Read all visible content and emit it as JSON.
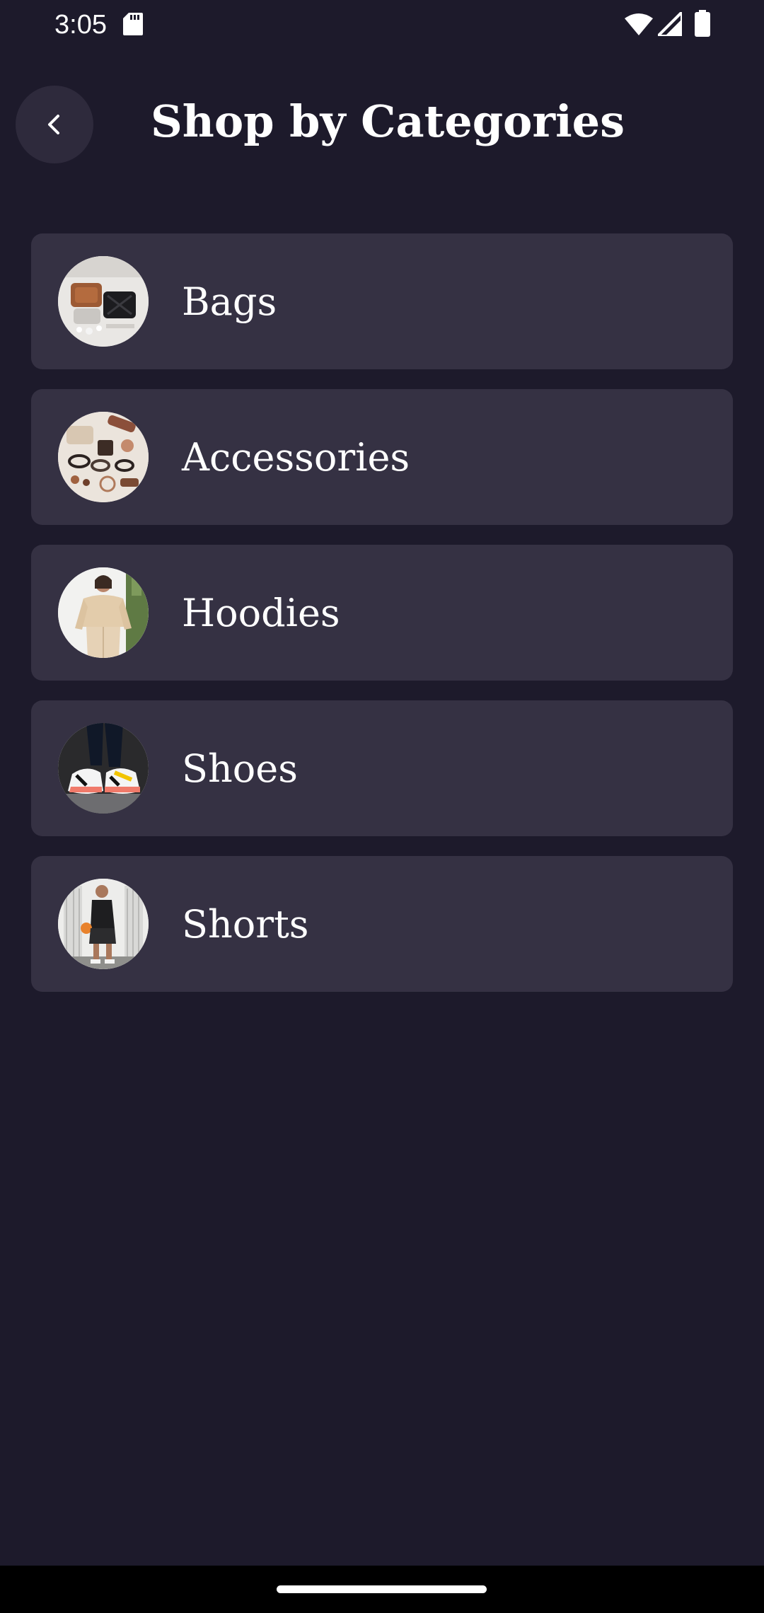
{
  "status_bar": {
    "time": "3:05",
    "icons": [
      "sd-card-icon",
      "wifi-icon",
      "cell-signal-icon",
      "battery-icon"
    ]
  },
  "header": {
    "back_icon": "chevron-left-icon",
    "title": "Shop by Categories"
  },
  "categories": [
    {
      "label": "Bags",
      "thumb": "bags-thumbnail"
    },
    {
      "label": "Accessories",
      "thumb": "accessories-thumbnail"
    },
    {
      "label": "Hoodies",
      "thumb": "hoodies-thumbnail"
    },
    {
      "label": "Shoes",
      "thumb": "shoes-thumbnail"
    },
    {
      "label": "Shorts",
      "thumb": "shorts-thumbnail"
    }
  ],
  "colors": {
    "background": "#1d1a2b",
    "card": "#353143",
    "back_button": "#2e2a3c",
    "text": "#ffffff"
  }
}
